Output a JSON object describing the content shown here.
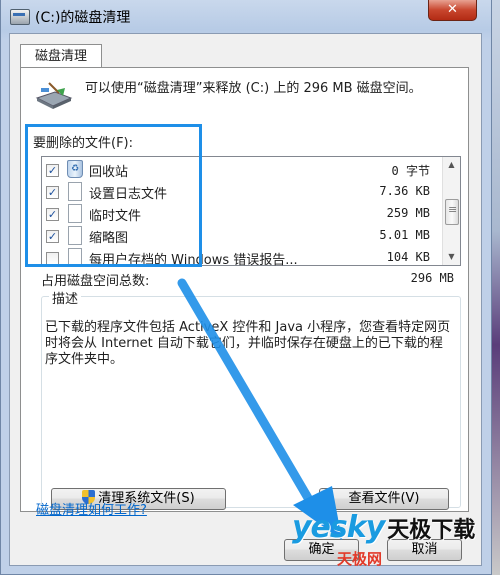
{
  "window": {
    "title": "(C:)的磁盘清理",
    "close_symbol": "✕"
  },
  "tab": {
    "label": "磁盘清理"
  },
  "info": {
    "text": "可以使用“磁盘清理”来释放  (C:) 上的 296 MB 磁盘空间。"
  },
  "files": {
    "label": "要删除的文件(F):",
    "items": [
      {
        "name": "回收站",
        "size": "0 字节",
        "checked": true,
        "icon": "recycle-bin-icon"
      },
      {
        "name": "设置日志文件",
        "size": "7.36 KB",
        "checked": true,
        "icon": "file-icon"
      },
      {
        "name": "临时文件",
        "size": "259 MB",
        "checked": true,
        "icon": "file-icon"
      },
      {
        "name": "缩略图",
        "size": "5.01 MB",
        "checked": true,
        "icon": "file-icon"
      },
      {
        "name": "每用户存档的 Windows 错误报告...",
        "size": "104 KB",
        "checked": false,
        "icon": "file-icon"
      }
    ]
  },
  "total": {
    "label": "占用磁盘空间总数:",
    "value": "296 MB"
  },
  "description": {
    "legend": "描述",
    "text": "已下载的程序文件包括 ActiveX 控件和 Java 小程序，您查看特定网页时将会从 Internet 自动下载它们，并临时保存在硬盘上的已下载的程序文件夹中。"
  },
  "buttons": {
    "cleanup": "清理系统文件(S)",
    "view": "查看文件(V)",
    "ok": "确定",
    "cancel": "取消"
  },
  "help_link": "磁盘清理如何工作?",
  "watermark": {
    "brand": "yesky",
    "site": "天极下载",
    "sub": "天极网"
  },
  "colors": {
    "highlight": "#1e8fe8",
    "link": "#0066cc",
    "watermark": "#1a9be0"
  }
}
